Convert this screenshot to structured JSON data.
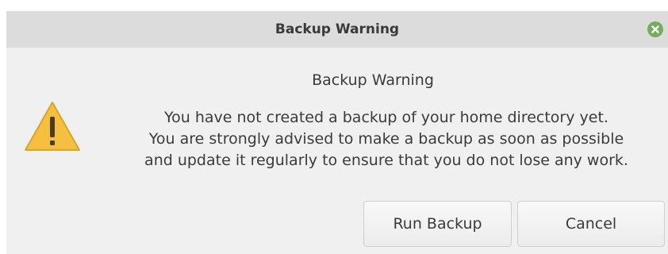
{
  "window": {
    "title": "Backup Warning"
  },
  "dialog": {
    "heading": "Backup Warning",
    "message_lines": [
      "You have not created a backup of your home directory yet.",
      "You are strongly advised to make a backup as soon as possible",
      "and update it regularly to ensure that you do not lose any work."
    ],
    "icon": "warning-triangle-icon"
  },
  "buttons": {
    "run_backup": "Run Backup",
    "cancel": "Cancel"
  },
  "colors": {
    "close_button": "#74ad5b",
    "warning_icon": "#f5c040",
    "titlebar": "#dcdcdc",
    "dialog_background": "#f0f0f0"
  }
}
